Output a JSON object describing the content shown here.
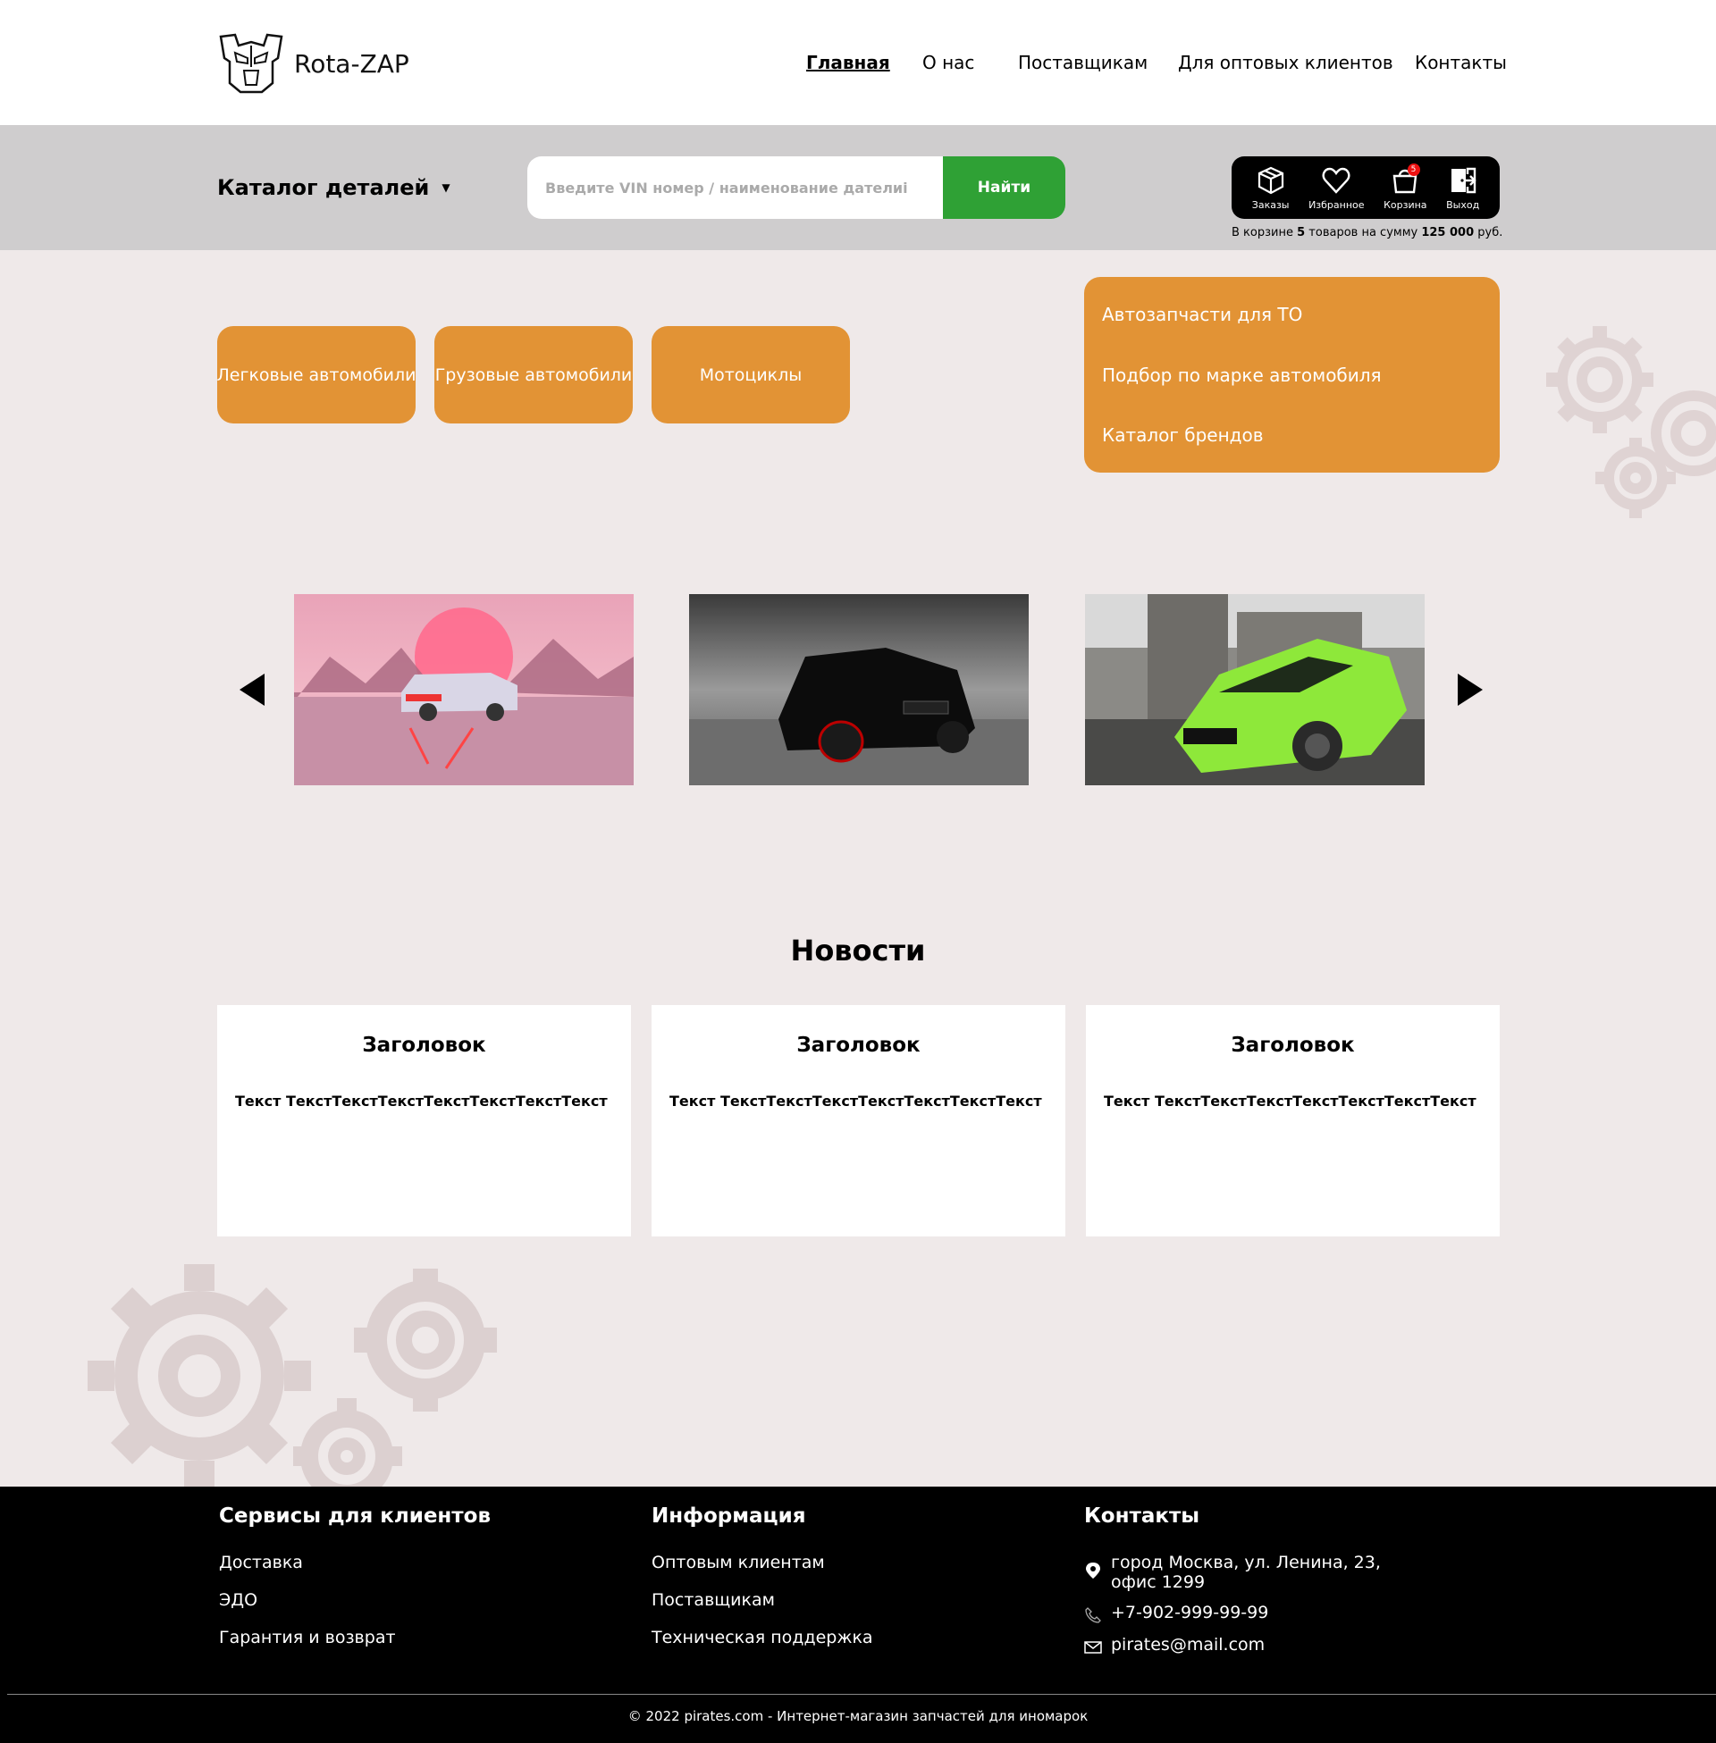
{
  "brand": {
    "name": "Rota-ZAP",
    "logo_icon": "autobot-logo-icon"
  },
  "nav": {
    "items": [
      {
        "label": "Главная",
        "active": true
      },
      {
        "label": "О нас"
      },
      {
        "label": "Поставщикам"
      },
      {
        "label": "Для оптовых клиентов"
      },
      {
        "label": "Контакты"
      }
    ]
  },
  "search": {
    "catalog_label": "Каталог деталей",
    "placeholder": "Введите VIN номер / наименование дателиi",
    "button_label": "Найти"
  },
  "userbar": {
    "orders": "Заказы",
    "favorites": "Избранное",
    "cart": "Корзина",
    "cart_count": "5",
    "logout": "Выход"
  },
  "cart_summary": {
    "prefix": "В корзине",
    "count": "5",
    "middle": "товаров на сумму",
    "amount": "125 000",
    "currency": "руб."
  },
  "categories": [
    "Легковые автомобили",
    "Грузовые автомобили",
    "Мотоциклы"
  ],
  "side_menu": [
    "Автозапчасти для ТО",
    "Подбор по марке автомобиля",
    "Каталог брендов"
  ],
  "news": {
    "title": "Новости",
    "cards": [
      {
        "title": "Заголовок",
        "text": "Текст ТекстТекстТекстТекстТекстТекстТекст"
      },
      {
        "title": "Заголовок",
        "text": "Текст ТекстТекстТекстТекстТекстТекстТекст"
      },
      {
        "title": "Заголовок",
        "text": "Текст ТекстТекстТекстТекстТекстТекстТекст"
      }
    ]
  },
  "footer": {
    "services": {
      "title": "Сервисы для клиентов",
      "links": [
        "Доставка",
        "ЭДО",
        "Гарантия и возврат"
      ]
    },
    "info": {
      "title": "Информация",
      "links": [
        "Оптовым клиентам",
        "Поставщикам",
        "Техническая поддержка"
      ]
    },
    "contacts": {
      "title": "Контакты",
      "address_line1": "город Москва, ул. Ленина, 23,",
      "address_line2": "офис 1299",
      "phone": "+7-902-999-99-99",
      "email": "pirates@mail.com"
    },
    "copyright": "© 2022 pirates.com - Интернет-магазин запчастей для иномарок"
  },
  "colors": {
    "accent": "#e29335",
    "search_button": "#2fa135",
    "footer_bg": "#000000",
    "page_bg": "#efe9e9"
  }
}
